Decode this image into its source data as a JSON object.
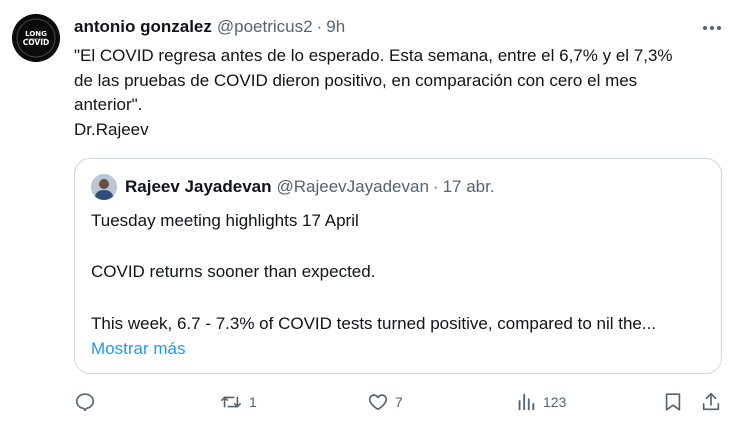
{
  "tweet": {
    "author_name": "antonio gonzalez",
    "author_handle": "@poetricus2",
    "separator": "·",
    "time": "9h",
    "avatar_text": [
      "LONG",
      "COVID"
    ],
    "text_lines": [
      "\"El COVID regresa antes de lo esperado. Esta semana, entre el 6,7% y el 7,3%",
      "de las pruebas de COVID dieron positivo, en comparación con cero el mes",
      "anterior\".",
      "Dr.Rajeev"
    ]
  },
  "quote": {
    "author_name": "Rajeev Jayadevan",
    "author_handle": "@RajeevJayadevan",
    "separator": "·",
    "time": "17 abr.",
    "lines": [
      "Tuesday meeting highlights 17 April",
      "COVID returns sooner than expected.",
      "This week, 6.7 - 7.3% of COVID tests turned positive, compared to nil the..."
    ],
    "show_more": "Mostrar más"
  },
  "actions": {
    "reply": {
      "icon": "reply-icon",
      "count": ""
    },
    "retweet": {
      "icon": "retweet-icon",
      "count": "1"
    },
    "like": {
      "icon": "heart-icon",
      "count": "7"
    },
    "views": {
      "icon": "views-icon",
      "count": "123"
    },
    "bookmark": {
      "icon": "bookmark-icon"
    },
    "share": {
      "icon": "share-icon"
    }
  },
  "colors": {
    "text": "#0f1419",
    "secondary": "#536471",
    "link": "#1d9bf0",
    "border": "#cfd9de"
  }
}
